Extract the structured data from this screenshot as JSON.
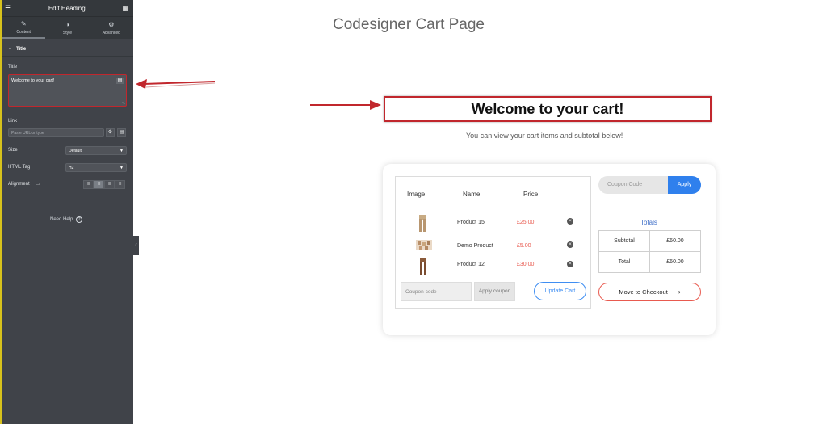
{
  "editor": {
    "panel_title": "Edit Heading",
    "tabs": [
      {
        "label": "Content",
        "icon": "pencil-icon"
      },
      {
        "label": "Style",
        "icon": "half-circle-icon"
      },
      {
        "label": "Advanced",
        "icon": "gear-icon"
      }
    ],
    "section_title": "Title",
    "title_label": "Title",
    "title_value": "Welcome to your cart!",
    "link_label": "Link",
    "link_placeholder": "Paste URL or type",
    "size_label": "Size",
    "size_value": "Default",
    "html_tag_label": "HTML Tag",
    "html_tag_value": "H2",
    "alignment_label": "Alignment",
    "need_help": "Need Help"
  },
  "page": {
    "title": "Codesigner Cart Page",
    "heading": "Welcome to your cart!",
    "subtitle": "You can view your cart items and subtotal below!"
  },
  "cart": {
    "headers": [
      "Image",
      "Name",
      "Price"
    ],
    "rows": [
      {
        "name": "Product 15",
        "price": "£25.00"
      },
      {
        "name": "Demo Product",
        "price": "£5.00"
      },
      {
        "name": "Product 12",
        "price": "£30.00"
      }
    ],
    "coupon_placeholder_left": "Coupon code",
    "apply_coupon_label": "Apply coupon",
    "update_cart_label": "Update Cart",
    "coupon_placeholder_right": "Coupon Code",
    "apply_label": "Apply",
    "totals_title": "Totals",
    "totals": [
      {
        "label": "Subtotal",
        "value": "£60.00"
      },
      {
        "label": "Total",
        "value": "£60.00"
      }
    ],
    "checkout_label": "Move to Checkout"
  },
  "colors": {
    "accent_blue": "#2f80ed",
    "price_red": "#e85a4f",
    "annotation_red": "#c1272d",
    "panel_bg": "#404349"
  }
}
